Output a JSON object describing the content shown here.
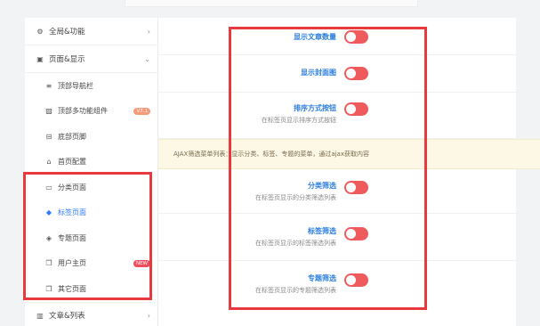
{
  "sidebar": {
    "groups": [
      {
        "label": "全局&功能",
        "icon": "settings-icon"
      },
      {
        "label": "页面&显示",
        "icon": "calendar-icon"
      },
      {
        "label": "文章&列表",
        "icon": "map-icon"
      }
    ],
    "items": [
      {
        "label": "顶部导航栏",
        "icon": "menu-icon"
      },
      {
        "label": "顶部多功能组件",
        "icon": "image-icon",
        "badge": "V7.1"
      },
      {
        "label": "底部页脚",
        "icon": "footer-icon"
      },
      {
        "label": "首页配置",
        "icon": "home-icon"
      },
      {
        "label": "分类页面",
        "icon": "folder-icon"
      },
      {
        "label": "标签页面",
        "icon": "tag-icon"
      },
      {
        "label": "专题页面",
        "icon": "cube-icon"
      },
      {
        "label": "用户主页",
        "icon": "copy-icon",
        "badge": "NEW"
      },
      {
        "label": "其它页面",
        "icon": "copy-icon"
      }
    ]
  },
  "settings": [
    {
      "title": "显示文章数量",
      "desc": "",
      "enabled": true
    },
    {
      "title": "显示封面图",
      "desc": "",
      "enabled": true
    },
    {
      "title": "排序方式按钮",
      "desc": "在标签页显示排序方式按钮",
      "enabled": true
    },
    {
      "title": "分类筛选",
      "desc": "在标签页显示的分类筛选列表",
      "enabled": true
    },
    {
      "title": "标签筛选",
      "desc": "在标签页显示的标签筛选列表",
      "enabled": true
    },
    {
      "title": "专题筛选",
      "desc": "在标签页显示的专题筛选列表",
      "enabled": true
    }
  ],
  "notice": "AJAX筛选菜单列表：显示分类、标签、专题的菜单，通过ajax获取内容",
  "colors": {
    "accent": "#2e7cf6",
    "toggle_on": "#ef5a5d",
    "highlight": "#e8393f",
    "notice_bg": "#fdf7e6"
  }
}
